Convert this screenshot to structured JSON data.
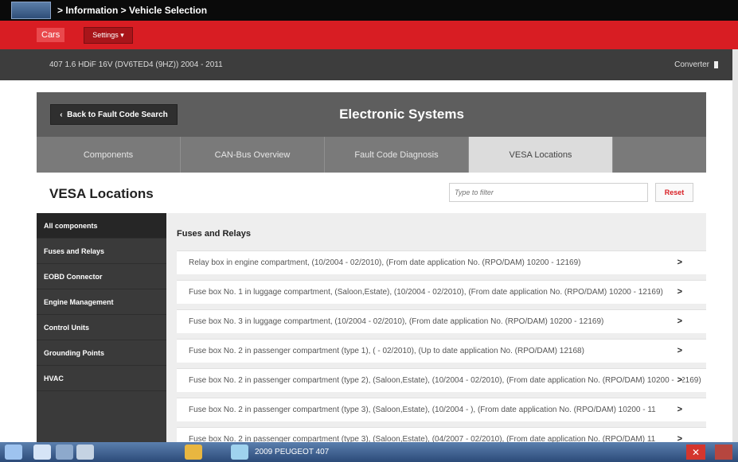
{
  "header": {
    "breadcrumb": "> Information   > Vehicle Selection",
    "cars_tab": "Cars",
    "settings_label": "Settings",
    "vehicle": "407 1.6 HDiF 16V (DV6TED4 (9HZ)) 2004 - 2011",
    "converter_label": "Converter"
  },
  "section": {
    "back_label": "Back to Fault Code Search",
    "title": "Electronic Systems",
    "tabs": [
      {
        "label": "Components"
      },
      {
        "label": "CAN-Bus Overview"
      },
      {
        "label": "Fault Code Diagnosis"
      },
      {
        "label": "VESA Locations",
        "active": true
      }
    ]
  },
  "vesa": {
    "title": "VESA Locations",
    "filter_placeholder": "Type to filter",
    "reset_label": "Reset"
  },
  "sidebar": {
    "items": [
      {
        "label": "All components",
        "active": true
      },
      {
        "label": "Fuses and Relays"
      },
      {
        "label": "EOBD Connector"
      },
      {
        "label": "Engine Management"
      },
      {
        "label": "Control Units"
      },
      {
        "label": "Grounding Points"
      },
      {
        "label": "HVAC"
      }
    ]
  },
  "content": {
    "title": "Fuses and Relays",
    "rows": [
      "Relay box in engine compartment, (10/2004 - 02/2010), (From date application No. (RPO/DAM) 10200 - 12169)",
      "Fuse box No. 1 in luggage compartment, (Saloon,Estate), (10/2004 - 02/2010), (From date application No. (RPO/DAM) 10200 - 12169)",
      "Fuse box No. 3 in luggage compartment, (10/2004 - 02/2010), (From date application No. (RPO/DAM) 10200 - 12169)",
      "Fuse box No. 2 in passenger compartment (type 1), ( - 02/2010), (Up to date application No. (RPO/DAM) 12168)",
      "Fuse box No. 2 in passenger compartment (type 2), (Saloon,Estate), (10/2004 - 02/2010), (From date application No. (RPO/DAM) 10200 - 12169)",
      "Fuse box No. 2 in passenger compartment (type 3), (Saloon,Estate), (10/2004 - ), (From date application No. (RPO/DAM) 10200 - 11",
      "Fuse box No. 2 in passenger compartment (type 3), (Saloon,Estate), (04/2007 - 02/2010), (From date application No. (RPO/DAM) 11"
    ],
    "arrow": ">"
  },
  "taskbar": {
    "label": "2009 PEUGEOT 407"
  }
}
